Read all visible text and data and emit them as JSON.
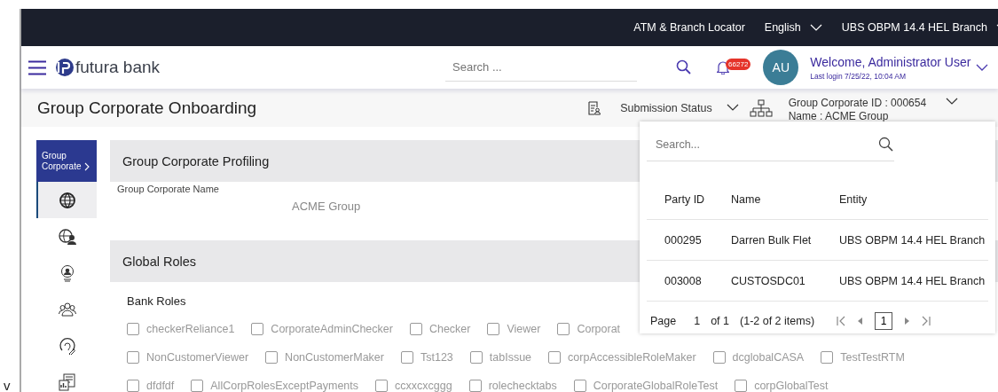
{
  "top_bar": {
    "links": [
      {
        "label": "ATM & Branch Locator",
        "dropdown": false
      },
      {
        "label": "English",
        "dropdown": true
      },
      {
        "label": "UBS OBPM 14.4 HEL Branch",
        "dropdown": true
      }
    ]
  },
  "header": {
    "logo_text": "futura bank",
    "search": {
      "placeholder": "Search ..."
    },
    "notification_count": "66272",
    "avatar": "AU",
    "welcome": "Welcome, Administrator User",
    "last_login": "Last login 7/25/22, 10:04 AM"
  },
  "page": {
    "title": "Group Corporate Onboarding",
    "submission_status": "Submission Status",
    "group_corporate_id": "Group Corporate ID : 000654",
    "group_corporate_name": "Name : ACME Group"
  },
  "sidebar": {
    "header": "Group Corporate",
    "items": [
      {
        "selected": true
      },
      {
        "selected": false
      },
      {
        "selected": false
      },
      {
        "selected": false
      },
      {
        "selected": false
      },
      {
        "selected": false
      }
    ]
  },
  "profiling": {
    "title": "Group Corporate Profiling",
    "field_label": "Group Corporate Name",
    "field_value": "ACME Group"
  },
  "global_roles": {
    "title": "Global Roles",
    "bank_roles_label": "Bank Roles",
    "rows": [
      [
        {
          "label": "checkerReliance1",
          "checked": false
        },
        {
          "label": "CorporateAdminChecker",
          "checked": false
        },
        {
          "label": "Checker",
          "checked": false
        },
        {
          "label": "Viewer",
          "checked": false
        },
        {
          "label": "Corporat",
          "checked": false
        }
      ],
      [
        {
          "label": "NonCustomerViewer",
          "checked": false
        },
        {
          "label": "NonCustomerMaker",
          "checked": false
        },
        {
          "label": "Tst123",
          "checked": false
        },
        {
          "label": "tabIssue",
          "checked": false
        },
        {
          "label": "corpAccessibleRoleMaker",
          "checked": false
        },
        {
          "label": "dcglobalCASA",
          "checked": false
        },
        {
          "label": "TestTestRTM",
          "checked": false
        }
      ],
      [
        {
          "label": "dfdfdf",
          "checked": false
        },
        {
          "label": "AllCorpRolesExceptPayments",
          "checked": false
        },
        {
          "label": "ccxxcxcggg",
          "checked": false
        },
        {
          "label": "rolechecktabs",
          "checked": false
        },
        {
          "label": "CorporateGlobalRoleTest",
          "checked": false
        },
        {
          "label": "corpGlobalTest",
          "checked": false
        }
      ]
    ]
  },
  "popover": {
    "search": {
      "placeholder": "Search..."
    },
    "columns": [
      "Party ID",
      "Name",
      "Entity"
    ],
    "rows": [
      [
        "000295",
        "Darren Bulk Flet",
        "UBS OBPM 14.4 HEL Branch"
      ],
      [
        "003008",
        "CUSTOSDC01",
        "UBS OBPM 14.4 HEL Branch"
      ]
    ],
    "pagination": {
      "page_label": "Page",
      "page": "1",
      "of": "of 1",
      "items": "(1-2 of 2 items)",
      "current": "1"
    }
  },
  "stray_text": "v"
}
